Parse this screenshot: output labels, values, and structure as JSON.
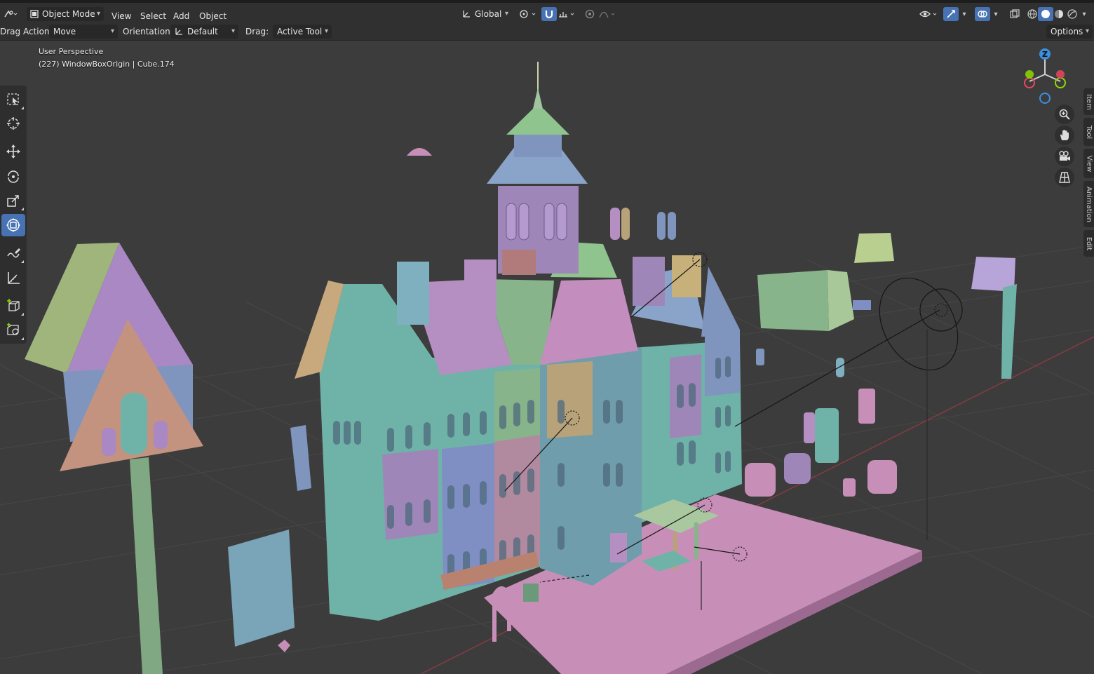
{
  "header": {
    "mode_label": "Object Mode",
    "menus": [
      "View",
      "Select",
      "Add",
      "Object"
    ],
    "transform_orientation": "Global"
  },
  "tool_settings": {
    "drag_action_label": "Drag Action:",
    "drag_action_value": "Move",
    "orientation_label": "Orientation:",
    "orientation_value": "Default",
    "drag_label": "Drag:",
    "drag_value": "Active Tool",
    "options_label": "Options"
  },
  "viewport": {
    "view_name": "User Perspective",
    "object_info": "(227) WindowBoxOrigin | Cube.174"
  },
  "gizmo": {
    "z_label": "Z",
    "x_color": "#e8475f",
    "y_color": "#8bdc00",
    "z_color": "#3b8fdd"
  },
  "sidebar_tabs": [
    "Item",
    "Tool",
    "View",
    "Animation",
    "Edit"
  ],
  "colors": {
    "accent": "#4772b3",
    "header_bg": "#303030",
    "viewport_bg": "#3c3c3c",
    "mesh_teal": "#6fb3a8",
    "mesh_pink": "#c78fb7",
    "mesh_purple": "#9f86b8",
    "mesh_green": "#87b48b",
    "mesh_blue": "#7f95bd",
    "mesh_tan": "#b8a27a"
  }
}
